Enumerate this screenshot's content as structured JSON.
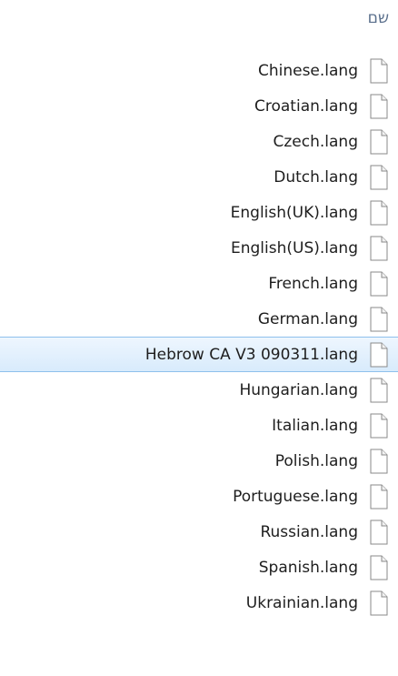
{
  "header": {
    "column_label": "שם"
  },
  "files": [
    {
      "name": "Chinese.lang",
      "icon": "document-icon",
      "selected": false
    },
    {
      "name": "Croatian.lang",
      "icon": "document-icon",
      "selected": false
    },
    {
      "name": "Czech.lang",
      "icon": "document-icon",
      "selected": false
    },
    {
      "name": "Dutch.lang",
      "icon": "document-icon",
      "selected": false
    },
    {
      "name": "English(UK).lang",
      "icon": "document-icon",
      "selected": false
    },
    {
      "name": "English(US).lang",
      "icon": "document-icon",
      "selected": false
    },
    {
      "name": "French.lang",
      "icon": "document-icon",
      "selected": false
    },
    {
      "name": "German.lang",
      "icon": "document-icon",
      "selected": false
    },
    {
      "name": "Hebrow CA V3 090311.lang",
      "icon": "document-icon",
      "selected": true
    },
    {
      "name": "Hungarian.lang",
      "icon": "document-icon",
      "selected": false
    },
    {
      "name": "Italian.lang",
      "icon": "document-icon",
      "selected": false
    },
    {
      "name": "Polish.lang",
      "icon": "document-icon",
      "selected": false
    },
    {
      "name": "Portuguese.lang",
      "icon": "document-icon",
      "selected": false
    },
    {
      "name": "Russian.lang",
      "icon": "document-icon",
      "selected": false
    },
    {
      "name": "Spanish.lang",
      "icon": "document-icon",
      "selected": false
    },
    {
      "name": "Ukrainian.lang",
      "icon": "document-icon",
      "selected": false
    }
  ],
  "colors": {
    "selection_fill": "#d8ebfc",
    "selection_border": "#8ec0ec",
    "header_text": "#5a6f8c"
  }
}
